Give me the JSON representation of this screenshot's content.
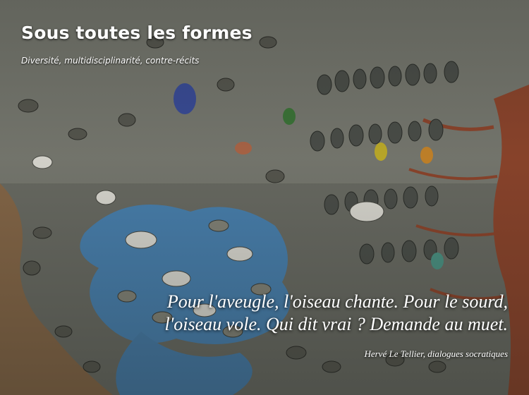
{
  "header": {
    "site_title": "Sous toutes les formes",
    "tagline": "Diversité, multidisciplinarité, contre-récits"
  },
  "quote": {
    "line1": "Pour l'aveugle, l'oiseau chante. Pour le sourd,",
    "line2": "l'oiseau vole. Qui dit vrai ? Demande au muet.",
    "author": "Hervé Le Tellier, dialogues socratiques"
  },
  "colors": {
    "title_text": "#ffffff",
    "water": "#4a86b8",
    "ground": "#8a6a4a",
    "tree_trunk": "#9a4a30",
    "background": "#2b2f2a"
  },
  "icons": {
    "hero_image": "bird-crowd-illustration"
  }
}
